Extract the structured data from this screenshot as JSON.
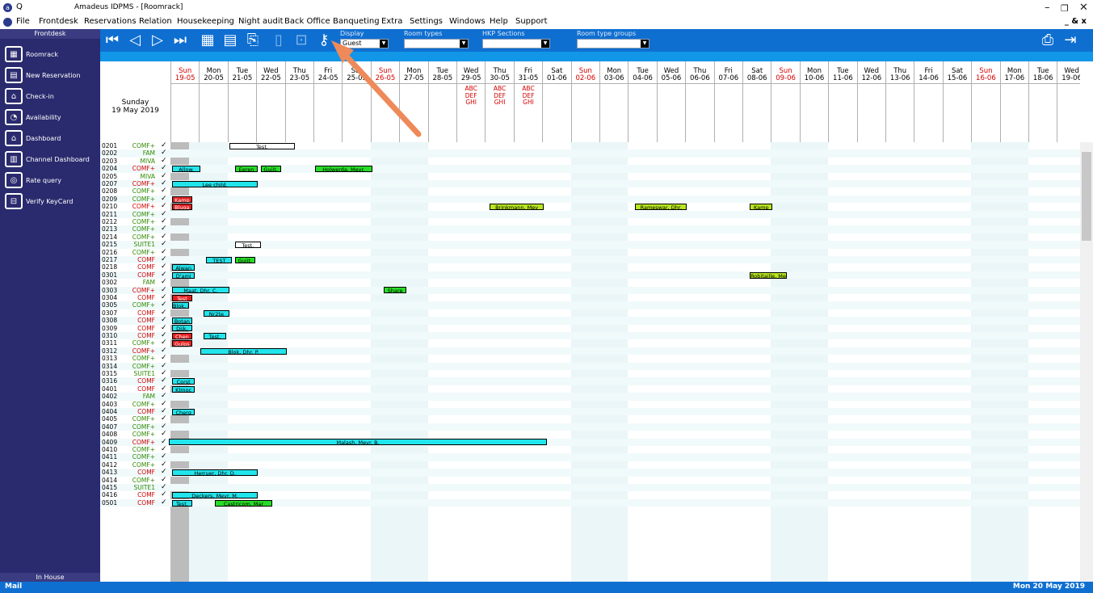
{
  "titlebar": {
    "app": "Amadeus IDPMS - [Roomrack]",
    "q": "Q"
  },
  "menu": {
    "items": [
      "File",
      "Frontdesk",
      "Reservations",
      "Relation",
      "Housekeeping",
      "Night audit",
      "Back Office",
      "Banqueting",
      "Extra",
      "Settings",
      "Windows",
      "Help",
      "Support"
    ],
    "right": "_ & x"
  },
  "sidebar": {
    "header": "Frontdesk",
    "footer": "In House",
    "items": [
      "Roomrack",
      "New Reservation",
      "Check-in",
      "Availability",
      "Dashboard",
      "Channel Dashboard",
      "Rate query",
      "Verify KeyCard"
    ]
  },
  "toolbar": {
    "display_label": "Display",
    "display_value": "Guest",
    "roomtypes_label": "Room types",
    "roomtypes_value": "",
    "hkp_label": "HKP Sections",
    "hkp_value": "",
    "rtg_label": "Room type groups",
    "rtg_value": ""
  },
  "header": {
    "day": "Sunday",
    "date": "19 May 2019"
  },
  "days": [
    {
      "n": "Sun",
      "d": "19-05",
      "w": true
    },
    {
      "n": "Mon",
      "d": "20-05"
    },
    {
      "n": "Tue",
      "d": "21-05"
    },
    {
      "n": "Wed",
      "d": "22-05"
    },
    {
      "n": "Thu",
      "d": "23-05"
    },
    {
      "n": "Fri",
      "d": "24-05"
    },
    {
      "n": "Sat",
      "d": "25-05"
    },
    {
      "n": "Sun",
      "d": "26-05",
      "w": true
    },
    {
      "n": "Mon",
      "d": "27-05"
    },
    {
      "n": "Tue",
      "d": "28-05"
    },
    {
      "n": "Wed",
      "d": "29-05",
      "abc": true
    },
    {
      "n": "Thu",
      "d": "30-05",
      "abc": true
    },
    {
      "n": "Fri",
      "d": "31-05",
      "abc": true
    },
    {
      "n": "Sat",
      "d": "01-06"
    },
    {
      "n": "Sun",
      "d": "02-06",
      "w": true
    },
    {
      "n": "Mon",
      "d": "03-06"
    },
    {
      "n": "Tue",
      "d": "04-06"
    },
    {
      "n": "Wed",
      "d": "05-06"
    },
    {
      "n": "Thu",
      "d": "06-06"
    },
    {
      "n": "Fri",
      "d": "07-06"
    },
    {
      "n": "Sat",
      "d": "08-06"
    },
    {
      "n": "Sun",
      "d": "09-06",
      "w": true
    },
    {
      "n": "Mon",
      "d": "10-06"
    },
    {
      "n": "Tue",
      "d": "11-06"
    },
    {
      "n": "Wed",
      "d": "12-06"
    },
    {
      "n": "Thu",
      "d": "13-06"
    },
    {
      "n": "Fri",
      "d": "14-06"
    },
    {
      "n": "Sat",
      "d": "15-06"
    },
    {
      "n": "Sun",
      "d": "16-06",
      "w": true
    },
    {
      "n": "Mon",
      "d": "17-06"
    },
    {
      "n": "Tue",
      "d": "18-06"
    },
    {
      "n": "Wed",
      "d": "19-06"
    }
  ],
  "abc_text": [
    "ABC",
    "DEF",
    "GHI"
  ],
  "rooms": [
    {
      "n": "0201",
      "t": "COMF+",
      "c": "green"
    },
    {
      "n": "0202",
      "t": "FAM",
      "c": "green"
    },
    {
      "n": "0203",
      "t": "MIVA",
      "c": "green"
    },
    {
      "n": "0204",
      "t": "COMF+",
      "c": "red"
    },
    {
      "n": "0205",
      "t": "MIVA",
      "c": "green"
    },
    {
      "n": "0207",
      "t": "COMF+",
      "c": "red"
    },
    {
      "n": "0208",
      "t": "COMF+",
      "c": "green"
    },
    {
      "n": "0209",
      "t": "COMF+",
      "c": "green"
    },
    {
      "n": "0210",
      "t": "COMF+",
      "c": "red"
    },
    {
      "n": "0211",
      "t": "COMF+",
      "c": "green"
    },
    {
      "n": "0212",
      "t": "COMF+",
      "c": "green"
    },
    {
      "n": "0213",
      "t": "COMF+",
      "c": "green"
    },
    {
      "n": "0214",
      "t": "COMF+",
      "c": "green"
    },
    {
      "n": "0215",
      "t": "SUITE1",
      "c": "green"
    },
    {
      "n": "0216",
      "t": "COMF+",
      "c": "green"
    },
    {
      "n": "0217",
      "t": "COMF",
      "c": "red"
    },
    {
      "n": "0218",
      "t": "COMF",
      "c": "red"
    },
    {
      "n": "0301",
      "t": "COMF",
      "c": "red"
    },
    {
      "n": "0302",
      "t": "FAM",
      "c": "green"
    },
    {
      "n": "0303",
      "t": "COMF+",
      "c": "red"
    },
    {
      "n": "0304",
      "t": "COMF",
      "c": "red"
    },
    {
      "n": "0305",
      "t": "COMF+",
      "c": "green"
    },
    {
      "n": "0307",
      "t": "COMF",
      "c": "red"
    },
    {
      "n": "0308",
      "t": "COMF",
      "c": "red"
    },
    {
      "n": "0309",
      "t": "COMF",
      "c": "red"
    },
    {
      "n": "0310",
      "t": "COMF",
      "c": "red"
    },
    {
      "n": "0311",
      "t": "COMF+",
      "c": "green"
    },
    {
      "n": "0312",
      "t": "COMF+",
      "c": "red"
    },
    {
      "n": "0313",
      "t": "COMF+",
      "c": "green"
    },
    {
      "n": "0314",
      "t": "COMF+",
      "c": "green"
    },
    {
      "n": "0315",
      "t": "SUITE1",
      "c": "green"
    },
    {
      "n": "0316",
      "t": "COMF",
      "c": "red"
    },
    {
      "n": "0401",
      "t": "COMF",
      "c": "red"
    },
    {
      "n": "0402",
      "t": "FAM",
      "c": "green"
    },
    {
      "n": "0403",
      "t": "COMF+",
      "c": "green"
    },
    {
      "n": "0404",
      "t": "COMF",
      "c": "red"
    },
    {
      "n": "0405",
      "t": "COMF+",
      "c": "green"
    },
    {
      "n": "0407",
      "t": "COMF+",
      "c": "green"
    },
    {
      "n": "0408",
      "t": "COMF+",
      "c": "green"
    },
    {
      "n": "0409",
      "t": "COMF+",
      "c": "red"
    },
    {
      "n": "0410",
      "t": "COMF+",
      "c": "green"
    },
    {
      "n": "0411",
      "t": "COMF+",
      "c": "green"
    },
    {
      "n": "0412",
      "t": "COMF+",
      "c": "green"
    },
    {
      "n": "0413",
      "t": "COMF",
      "c": "red"
    },
    {
      "n": "0414",
      "t": "COMF+",
      "c": "green"
    },
    {
      "n": "0415",
      "t": "SUITE1",
      "c": "green"
    },
    {
      "n": "0416",
      "t": "COMF",
      "c": "red"
    },
    {
      "n": "0501",
      "t": "COMF",
      "c": "red"
    }
  ],
  "bookings": [
    {
      "r": 0,
      "s": 2,
      "len": 2.3,
      "label": "Test.",
      "c": "white"
    },
    {
      "r": 3,
      "s": 0,
      "len": 1,
      "label": "Allow.",
      "c": "cyan"
    },
    {
      "r": 3,
      "s": 2.2,
      "len": 0.8,
      "label": "Eeren",
      "c": "green"
    },
    {
      "r": 3,
      "s": 3.1,
      "len": 0.7,
      "label": "Guijt.",
      "c": "green"
    },
    {
      "r": 3,
      "s": 5,
      "len": 2,
      "label": "Holwerda, Mevr.",
      "c": "green"
    },
    {
      "r": 5,
      "s": 0,
      "len": 3,
      "label": "Lee child.",
      "c": "cyan"
    },
    {
      "r": 7,
      "s": 0,
      "len": 0.7,
      "label": "Kamp",
      "c": "red"
    },
    {
      "r": 8,
      "s": 0,
      "len": 0.7,
      "label": "Bluga",
      "c": "red"
    },
    {
      "r": 8,
      "s": 11.1,
      "len": 1.9,
      "label": "Brinkmann, Mev",
      "c": "lime"
    },
    {
      "r": 8,
      "s": 16.2,
      "len": 1.8,
      "label": "Rameswar, Dhr.",
      "c": "lime"
    },
    {
      "r": 8,
      "s": 20.2,
      "len": 0.8,
      "label": "Kamp",
      "c": "lime"
    },
    {
      "r": 13,
      "s": 2.2,
      "len": 0.9,
      "label": "Test.",
      "c": "white"
    },
    {
      "r": 15,
      "s": 1.2,
      "len": 0.9,
      "label": "TEST",
      "c": "cyan"
    },
    {
      "r": 15,
      "s": 2.2,
      "len": 0.7,
      "label": "Guijt.",
      "c": "green"
    },
    {
      "r": 16,
      "s": 0,
      "len": 0.8,
      "label": "Alwan",
      "c": "cyan"
    },
    {
      "r": 17,
      "s": 0,
      "len": 0.8,
      "label": "D'ami",
      "c": "cyan"
    },
    {
      "r": 17,
      "s": 20.2,
      "len": 1.3,
      "label": "Robitaille, Mevr.",
      "c": "lime"
    },
    {
      "r": 19,
      "s": 0,
      "len": 2,
      "label": "Maat, Dhr. C.",
      "c": "cyan"
    },
    {
      "r": 19,
      "s": 7.4,
      "len": 0.8,
      "label": "Share",
      "c": "green"
    },
    {
      "r": 20,
      "s": 0,
      "len": 0.7,
      "label": "Test",
      "c": "red"
    },
    {
      "r": 21,
      "s": 0,
      "len": 0.6,
      "label": "Blok, Dh",
      "c": "cyan"
    },
    {
      "r": 22,
      "s": 1.1,
      "len": 0.9,
      "label": "Nr2te",
      "c": "cyan"
    },
    {
      "r": 23,
      "s": 0,
      "len": 0.7,
      "label": "Botan",
      "c": "cyan"
    },
    {
      "r": 24,
      "s": 0,
      "len": 0.7,
      "label": "Dijk,",
      "c": "cyan"
    },
    {
      "r": 25,
      "s": 0,
      "len": 0.7,
      "label": "Chen",
      "c": "red"
    },
    {
      "r": 25,
      "s": 1.1,
      "len": 0.8,
      "label": "Test.",
      "c": "cyan"
    },
    {
      "r": 26,
      "s": 0,
      "len": 0.7,
      "label": "Gulps",
      "c": "red"
    },
    {
      "r": 27,
      "s": 1,
      "len": 3,
      "label": "Blok, Dhr. P.",
      "c": "cyan"
    },
    {
      "r": 31,
      "s": 0,
      "len": 0.8,
      "label": "Corst",
      "c": "cyan"
    },
    {
      "r": 32,
      "s": 0,
      "len": 0.8,
      "label": "Klmoc",
      "c": "cyan"
    },
    {
      "r": 35,
      "s": 0,
      "len": 0.8,
      "label": "Cherg",
      "c": "cyan"
    },
    {
      "r": 39,
      "s": -0.1,
      "len": 13.2,
      "label": "Malash, Mevr. B.",
      "c": "cyan"
    },
    {
      "r": 43,
      "s": 0,
      "len": 3,
      "label": "Herruer, Dhr. D.",
      "c": "cyan"
    },
    {
      "r": 46,
      "s": 0,
      "len": 3,
      "label": "Deckers, Mevr. M.",
      "c": "cyan"
    },
    {
      "r": 47,
      "s": 0,
      "len": 0.7,
      "label": "Test.",
      "c": "cyan"
    },
    {
      "r": 47,
      "s": 1.5,
      "len": 2,
      "label": "Castricom, Mar",
      "c": "green"
    }
  ],
  "status": {
    "mail": "Mail",
    "date": "Mon 20 May 2019"
  }
}
